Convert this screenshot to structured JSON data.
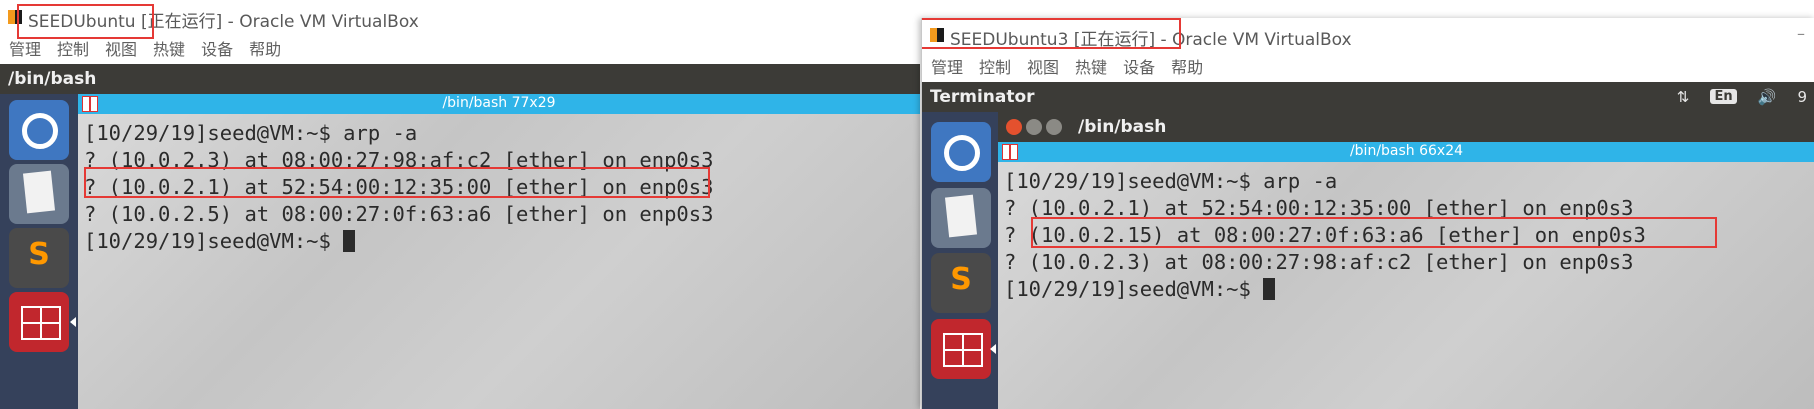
{
  "left_window": {
    "title": "SEEDUbuntu [正在运行] - Oracle VM VirtualBox",
    "menu": [
      "管理",
      "控制",
      "视图",
      "热键",
      "设备",
      "帮助"
    ],
    "guest_title": "/bin/bash",
    "terminal_tab_title": "/bin/bash 77x29",
    "terminal_lines": [
      "[10/29/19]seed@VM:~$ arp -a",
      "? (10.0.2.3) at 08:00:27:98:af:c2 [ether] on enp0s3",
      "? (10.0.2.1) at 52:54:00:12:35:00 [ether] on enp0s3",
      "? (10.0.2.5) at 08:00:27:0f:63:a6 [ether] on enp0s3"
    ],
    "prompt": "[10/29/19]seed@VM:~$ "
  },
  "right_window": {
    "title": "SEEDUbuntu3 [正在运行] - Oracle VM VirtualBox",
    "menu": [
      "管理",
      "控制",
      "视图",
      "热键",
      "设备",
      "帮助"
    ],
    "guest_title": "Terminator",
    "tray": {
      "sort": "⇅",
      "lang": "En",
      "volume": "🔊",
      "clock": "9"
    },
    "terminal_window_title": "/bin/bash",
    "terminal_tab_title": "/bin/bash 66x24",
    "terminal_lines": [
      "[10/29/19]seed@VM:~$ arp -a",
      "? (10.0.2.1) at 52:54:00:12:35:00 [ether] on enp0s3",
      "? (10.0.2.15) at 08:00:27:0f:63:a6 [ether] on enp0s3",
      "? (10.0.2.3) at 08:00:27:98:af:c2 [ether] on enp0s3"
    ],
    "prompt": "[10/29/19]seed@VM:~$ "
  },
  "launcher_icons": [
    "ubuntu-dash-icon",
    "text-editor-icon",
    "sublime-text-icon",
    "terminator-icon"
  ],
  "colors": {
    "tab_bar": "#2fb4e8",
    "highlight": "#e53935",
    "launcher": "#35415b"
  }
}
